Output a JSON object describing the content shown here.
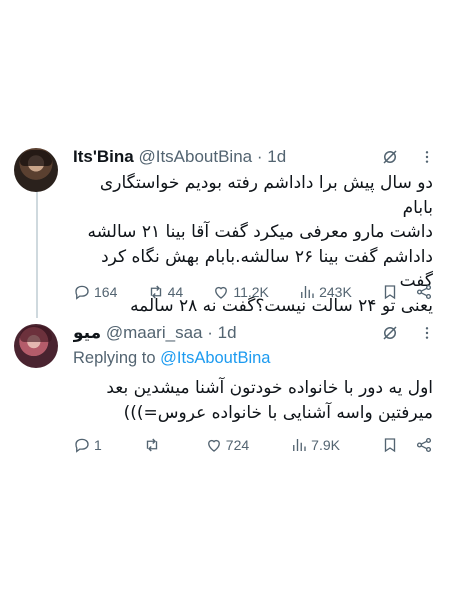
{
  "tweets": [
    {
      "display_name": "Its'Bina",
      "handle": "@ItsAboutBina",
      "dot": "·",
      "time": "1d",
      "body_lines": [
        "دو سال پیش برا داداشم رفته بودیم خواستگاری بابام",
        "داشت مارو معرفی میکرد گفت آقا بینا ۲۱ سالشه",
        "داداشم گفت بینا ۲۶ سالشه.بابام بهش نگاه کرد گفت",
        "یعنی تو ۲۴ سالت نیست؟گفت نه ۲۸ سالمه"
      ],
      "replies": "164",
      "reposts": "44",
      "likes": "11.2K",
      "views": "243K"
    },
    {
      "display_name": "میو",
      "handle": "@maari_saa",
      "dot": "·",
      "time": "1d",
      "replying_prefix": "Replying to",
      "replying_to": "@ItsAboutBina",
      "body_lines": [
        "اول یه دور با خانواده خودتون آشنا میشدین بعد",
        "میرفتین واسه آشنایی با خانواده عروس=)))"
      ],
      "replies": "1",
      "reposts": "",
      "likes": "724",
      "views": "7.9K"
    }
  ],
  "icons": {
    "grok": "grok-icon",
    "more": "more-dots-icon",
    "reply": "reply-bubble-icon",
    "repost": "repost-arrows-icon",
    "like": "heart-icon",
    "views": "views-bar-chart-icon",
    "bookmark": "bookmark-icon",
    "share": "share-icon"
  },
  "colors": {
    "text": "#0f1419",
    "secondary": "#536471",
    "link": "#1d9bf0",
    "thread_line": "#cfd9de"
  }
}
